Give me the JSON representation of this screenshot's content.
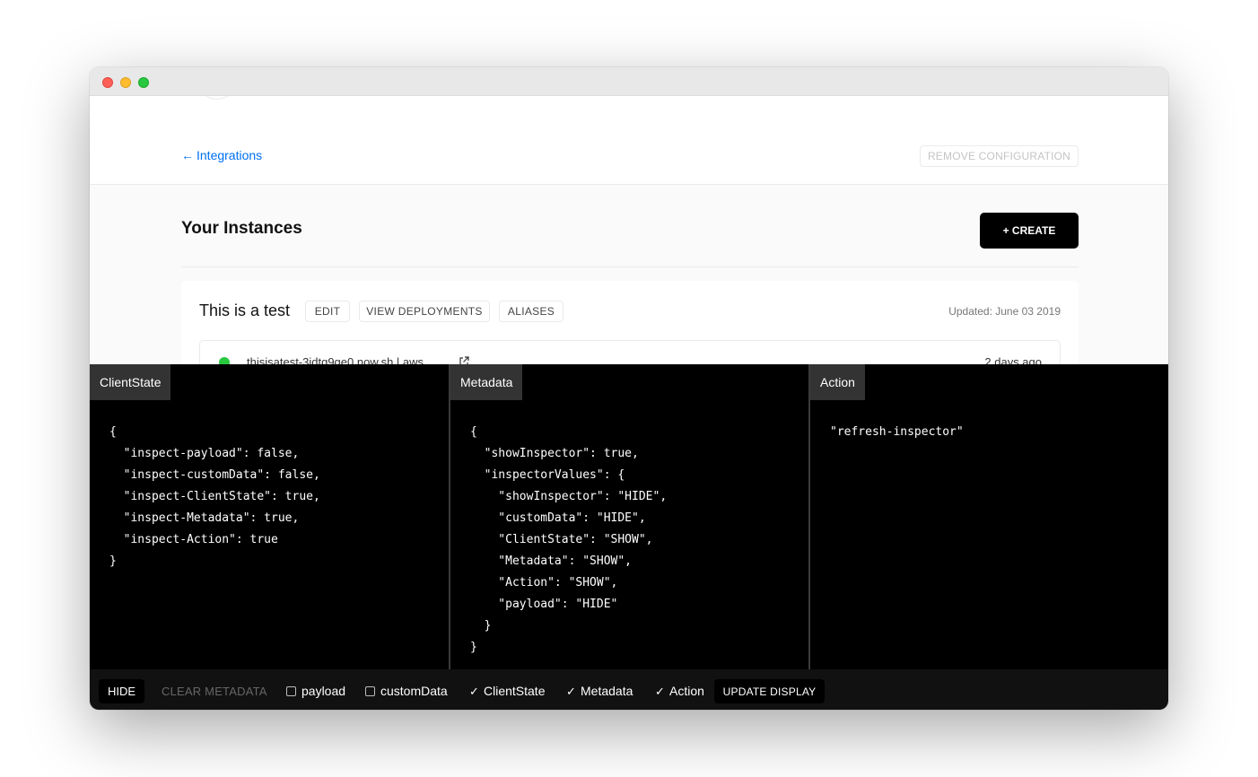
{
  "page": {
    "back_link": "Integrations",
    "remove_config_label": "REMOVE CONFIGURATION",
    "instances_title": "Your Instances",
    "create_label": "+ CREATE"
  },
  "instance": {
    "title": "This is a test",
    "buttons": {
      "edit": "EDIT",
      "view_deployments": "VIEW DEPLOYMENTS",
      "aliases": "ALIASES"
    },
    "updated": "Updated: June 03 2019",
    "deployment": {
      "url": "thisisatest-3idtg9ge0.now.sh | aws",
      "ago": "2 days ago",
      "status_color": "#28c840"
    }
  },
  "inspector": {
    "panels": [
      {
        "title": "ClientState",
        "code": "{\n  \"inspect-payload\": false,\n  \"inspect-customData\": false,\n  \"inspect-ClientState\": true,\n  \"inspect-Metadata\": true,\n  \"inspect-Action\": true\n}"
      },
      {
        "title": "Metadata",
        "code": "{\n  \"showInspector\": true,\n  \"inspectorValues\": {\n    \"showInspector\": \"HIDE\",\n    \"customData\": \"HIDE\",\n    \"ClientState\": \"SHOW\",\n    \"Metadata\": \"SHOW\",\n    \"Action\": \"SHOW\",\n    \"payload\": \"HIDE\"\n  }\n}"
      },
      {
        "title": "Action",
        "code": "\"refresh-inspector\""
      }
    ],
    "footer": {
      "hide_label": "HIDE",
      "clear_label": "CLEAR METADATA",
      "toggles": [
        {
          "label": "payload",
          "checked": false
        },
        {
          "label": "customData",
          "checked": false
        },
        {
          "label": "ClientState",
          "checked": true
        },
        {
          "label": "Metadata",
          "checked": true
        },
        {
          "label": "Action",
          "checked": true
        }
      ],
      "update_label": "UPDATE DISPLAY"
    }
  },
  "icons": {
    "back": "arrow-left-icon",
    "external": "external-link-icon",
    "check": "checkmark-icon"
  }
}
